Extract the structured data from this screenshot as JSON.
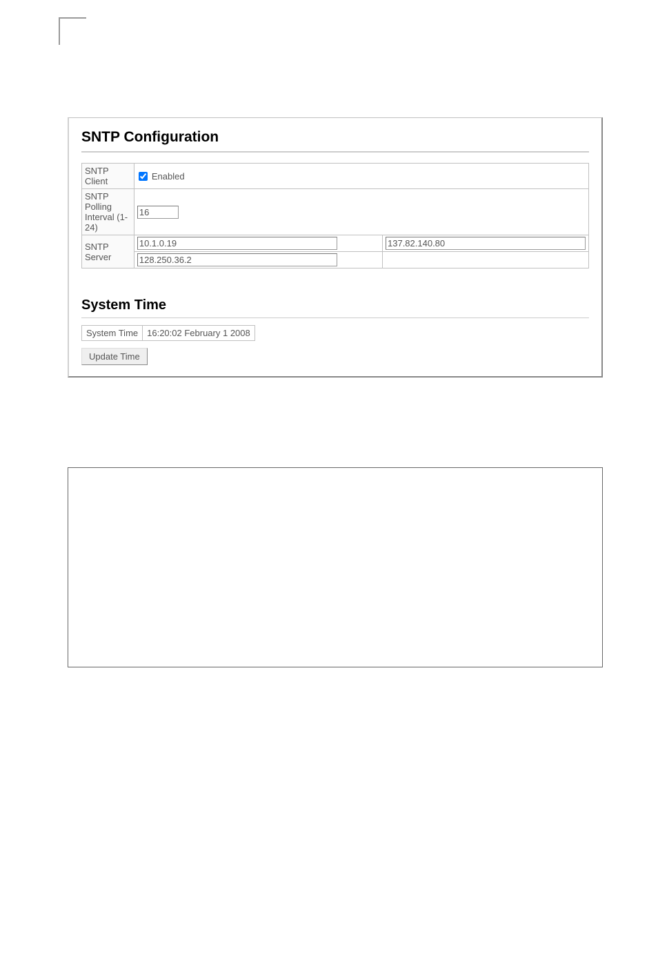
{
  "sntp": {
    "heading": "SNTP Configuration",
    "rows": {
      "client_label": "SNTP Client",
      "client_enabled_label": "Enabled",
      "client_enabled": true,
      "polling_label": "SNTP Polling Interval (1-24)",
      "polling_value": "16",
      "server_label": "SNTP Server",
      "server1": "10.1.0.19",
      "server2": "137.82.140.80",
      "server3": "128.250.36.2"
    }
  },
  "systime": {
    "heading": "System Time",
    "label": "System Time",
    "value": "16:20:02 February 1 2008",
    "button": "Update Time"
  }
}
